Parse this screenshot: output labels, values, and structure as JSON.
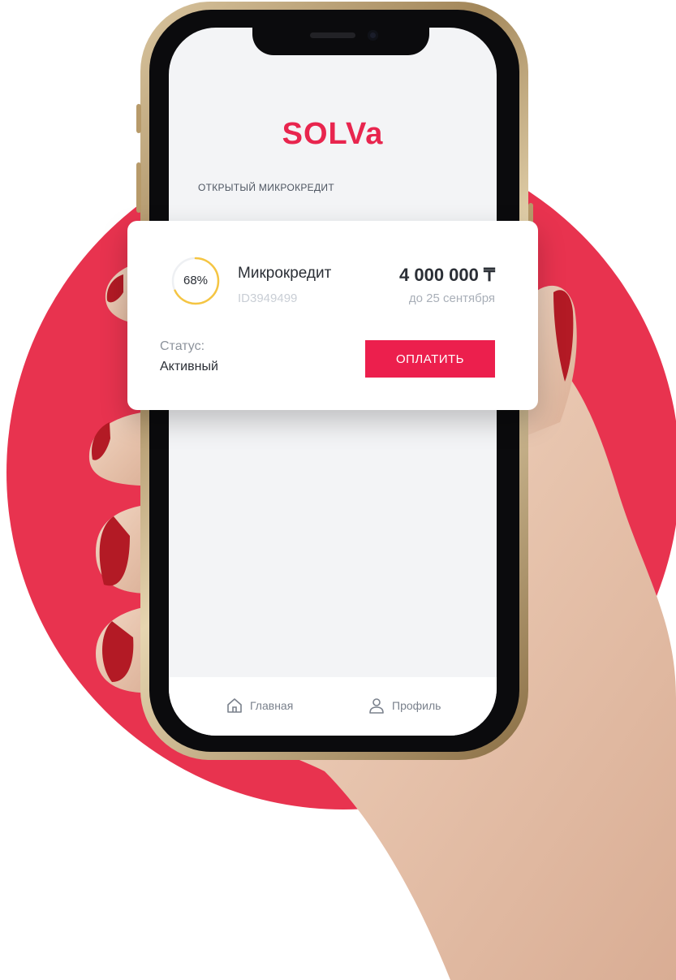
{
  "app": {
    "logo": "SOLVa",
    "section_title": "ОТКРЫТЫЙ МИКРОКРЕДИТ"
  },
  "loan": {
    "progress_label": "68%",
    "progress_fraction": 0.68,
    "product_name": "Микрокредит",
    "id": "ID3949499",
    "amount": "4 000 000 ₸",
    "due": "до 25 сентября",
    "status_label": "Статус:",
    "status_value": "Активный",
    "pay_button": "ОПЛАТИТЬ"
  },
  "tabbar": {
    "items": [
      {
        "label": "Главная",
        "icon": "home-icon"
      },
      {
        "label": "Профиль",
        "icon": "user-icon"
      }
    ]
  },
  "colors": {
    "brand": "#e8254e",
    "button": "#ec1f4d",
    "progress_ring": "#f5c542",
    "background_circle": "#e8334f"
  }
}
